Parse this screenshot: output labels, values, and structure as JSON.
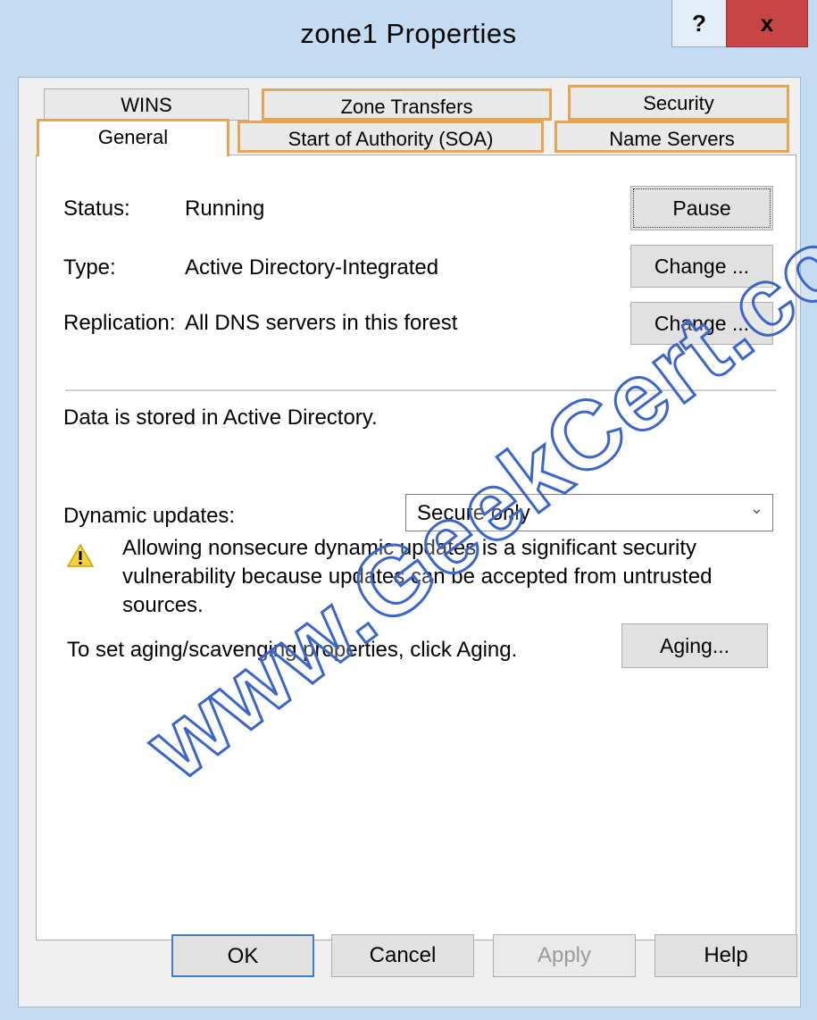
{
  "window": {
    "title": "zone1 Properties",
    "help_label": "?",
    "close_label": "x"
  },
  "tabs": {
    "row1": [
      "WINS",
      "Zone Transfers",
      "Security"
    ],
    "row2": [
      "General",
      "Start of Authority (SOA)",
      "Name Servers"
    ],
    "active": "General"
  },
  "general": {
    "status_label": "Status:",
    "status_value": "Running",
    "pause_button": "Pause",
    "type_label": "Type:",
    "type_value": "Active Directory-Integrated",
    "type_change_button": "Change ...",
    "replication_label": "Replication:",
    "replication_value": "All DNS servers in this forest",
    "replication_change_button": "Change ...",
    "storage_text": "Data is stored in Active Directory.",
    "dynamic_updates_label": "Dynamic updates:",
    "dynamic_updates_value": "Secure only",
    "warning_text": "Allowing nonsecure dynamic updates is a significant security vulnerability because updates can be accepted from untrusted sources.",
    "aging_text": "To set aging/scavenging properties, click Aging.",
    "aging_button": "Aging..."
  },
  "footer": {
    "ok": "OK",
    "cancel": "Cancel",
    "apply": "Apply",
    "help": "Help"
  },
  "watermark": "www.GeekCert.com",
  "colors": {
    "highlight": "#e5a552",
    "close_red": "#c74545",
    "watermark_blue": "#3c66c6"
  }
}
